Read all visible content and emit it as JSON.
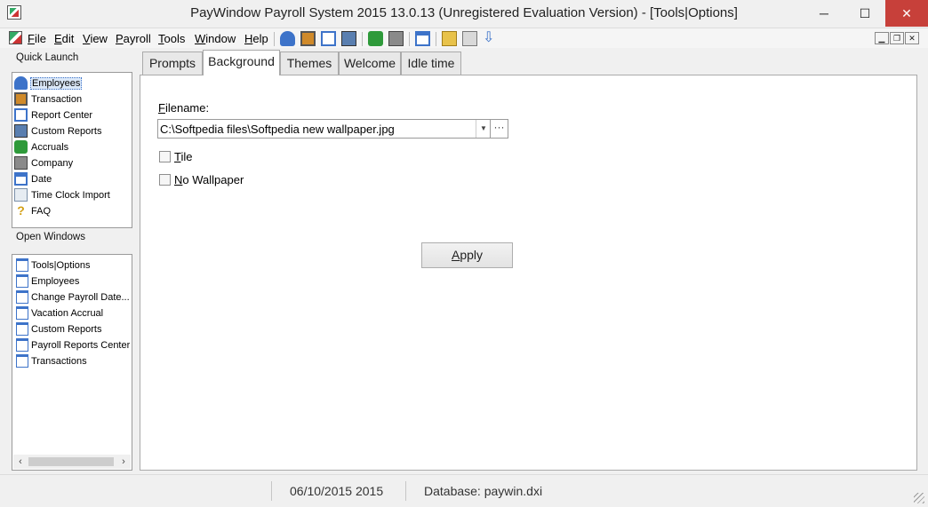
{
  "window": {
    "title": "PayWindow Payroll System 2015  13.0.13 (Unregistered Evaluation Version) - [Tools|Options]",
    "minimize_glyph": "─",
    "maximize_glyph": "☐",
    "close_glyph": "✕"
  },
  "menu": {
    "items": [
      {
        "key": "F",
        "rest": "ile"
      },
      {
        "key": "E",
        "rest": "dit"
      },
      {
        "key": "V",
        "rest": "iew"
      },
      {
        "key": "P",
        "rest": "ayroll"
      },
      {
        "key": "T",
        "rest": "ools"
      },
      {
        "key": "W",
        "rest": "indow"
      },
      {
        "key": "H",
        "rest": "elp"
      }
    ]
  },
  "toolbar": {
    "icons": [
      "employees-icon",
      "transaction-icon",
      "report-center-icon",
      "custom-reports-icon",
      "accruals-icon",
      "company-icon",
      "date-icon",
      "open-folder-icon",
      "folder-search-icon",
      "download-arrow-icon"
    ]
  },
  "mdi_controls": {
    "minimize": "▁",
    "restore": "❐",
    "close": "✕"
  },
  "quick_launch": {
    "heading": "Quick Launch",
    "items": [
      {
        "label": "Employees",
        "icon": "employees-icon",
        "color": "#3d73c9"
      },
      {
        "label": "Transaction",
        "icon": "transaction-icon",
        "color": "#d08a2a"
      },
      {
        "label": "Report Center",
        "icon": "report-center-icon",
        "color": "#3d73c9"
      },
      {
        "label": "Custom Reports",
        "icon": "custom-reports-icon",
        "color": "#5a7fb0"
      },
      {
        "label": "Accruals",
        "icon": "accruals-icon",
        "color": "#2e9a3a"
      },
      {
        "label": "Company",
        "icon": "company-icon",
        "color": "#6b6b6b"
      },
      {
        "label": "Date",
        "icon": "date-icon",
        "color": "#3d73c9"
      },
      {
        "label": "Time Clock Import",
        "icon": "time-clock-icon",
        "color": "#7a8fa8"
      },
      {
        "label": "FAQ",
        "icon": "faq-icon",
        "color": "#d4a017"
      }
    ]
  },
  "open_windows": {
    "heading": "Open Windows",
    "items": [
      "Tools|Options",
      "Employees",
      "Change Payroll Date...",
      "Vacation Accrual",
      "Custom Reports",
      "Payroll Reports Center",
      "Transactions"
    ]
  },
  "tabs": [
    "Prompts",
    "Background",
    "Themes",
    "Welcome",
    "Idle time"
  ],
  "active_tab": "Background",
  "background": {
    "filename_label_key": "F",
    "filename_label_rest": "ilename:",
    "filename_value": "C:\\Softpedia files\\Softpedia new wallpaper.jpg",
    "tile_key": "T",
    "tile_rest": "ile",
    "no_wallpaper_key": "N",
    "no_wallpaper_rest": "o Wallpaper",
    "tile_checked": false,
    "no_wallpaper_checked": false,
    "apply_key": "A",
    "apply_rest": "pply"
  },
  "status": {
    "date": "06/10/2015 2015",
    "database": "Database: paywin.dxi"
  },
  "colors": {
    "close_button": "#c7403a",
    "selection": "#dbe8f8",
    "accent": "#3d73c9"
  }
}
